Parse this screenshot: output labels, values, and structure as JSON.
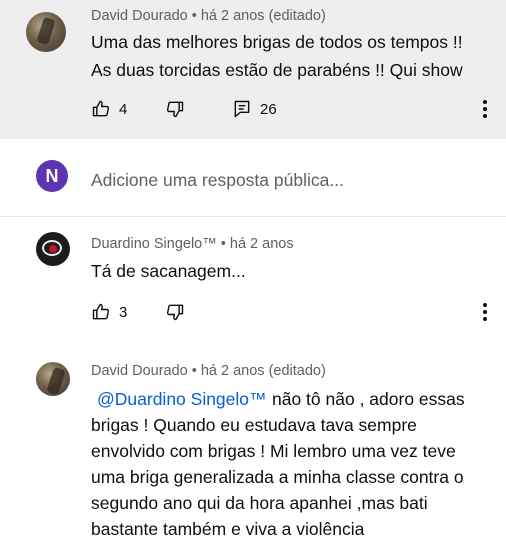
{
  "comments": [
    {
      "author": "David Dourado",
      "meta": "David Dourado • há 2 anos (editado)",
      "lines": [
        "Uma das melhores brigas de todos os tempos !!",
        "As duas torcidas estão de parabéns !! Qui show"
      ],
      "likes": "4",
      "replies": "26"
    },
    {
      "author": "Duardino Singelo™",
      "meta": "Duardino Singelo™ • há 2 anos",
      "lines": [
        "Tá de sacanagem..."
      ],
      "likes": "3"
    },
    {
      "author": "David Dourado",
      "meta": "David Dourado • há 2 anos (editado)",
      "mention": "@Duardino Singelo™",
      "lines": [
        "não tô não , adoro essas",
        "brigas ! Quando eu estudava tava  sempre",
        "envolvido com brigas ! Mi lembro uma vez teve",
        "uma briga generalizada a minha classe contra o",
        "segundo ano  qui da hora apanhei ,mas bati",
        "bastante também e viva a violência"
      ]
    }
  ],
  "reply": {
    "avatar_letter": "N",
    "placeholder": "Adicione uma resposta pública..."
  },
  "colors": {
    "highlight_bg": "#eeeeee",
    "mention": "#065fd4",
    "avatar_letter_bg": "#5e35b1",
    "meta_text": "#606060"
  },
  "icons": [
    "thumb-up-icon",
    "thumb-down-icon",
    "reply-count-icon",
    "more-vert-icon"
  ]
}
